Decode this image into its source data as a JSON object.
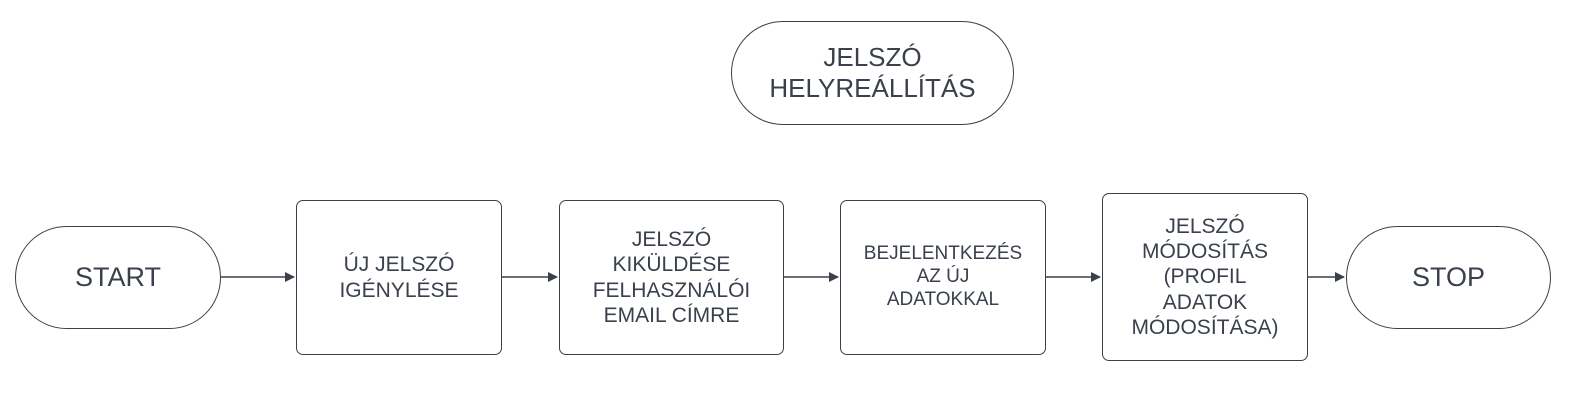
{
  "title": "JELSZÓ\nHELYREÁLLÍTÁS",
  "nodes": {
    "start": "START",
    "step1": "ÚJ JELSZÓ\nIGÉNYLÉSE",
    "step2": "JELSZÓ\nKIKÜLDÉSE\nFELHASZNÁLÓI\nEMAIL CÍMRE",
    "step3": "BEJELENTKEZÉS\nAZ ÚJ\nADATOKKAL",
    "step4": "JELSZÓ\nMÓDOSÍTÁS\n(PROFIL\nADATOK\nMÓDOSÍTÁSA)",
    "stop": "STOP"
  },
  "colors": {
    "stroke": "#3a414c",
    "background": "#ffffff"
  }
}
